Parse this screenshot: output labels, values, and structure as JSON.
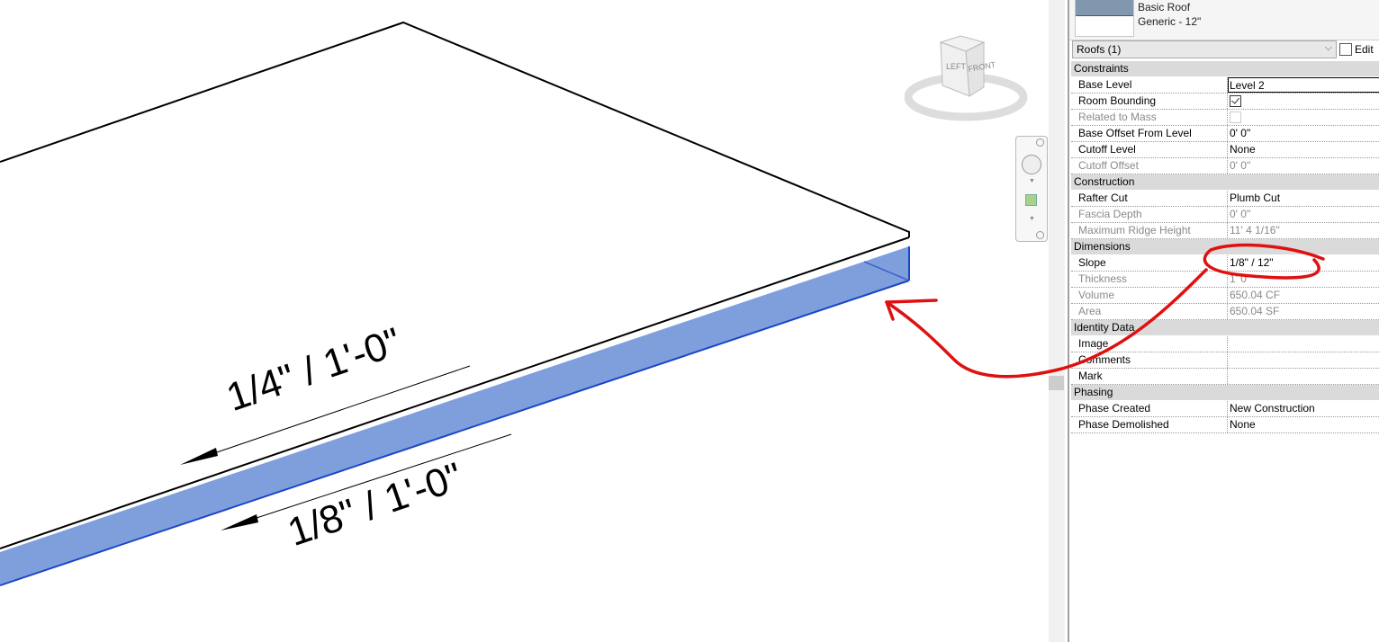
{
  "viewport": {
    "annotations": [
      "1/4\" / 1'-0\"",
      "1/8\" / 1'-0\""
    ],
    "viewcube": {
      "left_face": "LEFT",
      "front_face": "FRONT"
    },
    "colors": {
      "selection_face": "#7f9fdc",
      "selection_edge": "#1a45c8",
      "markup": "#e01010"
    }
  },
  "properties": {
    "type_family": "Basic Roof",
    "type_name": "Generic - 12\"",
    "filter": "Roofs (1)",
    "edit_type": "Edit",
    "groups": [
      {
        "name": "Constraints",
        "rows": [
          {
            "label": "Base Level",
            "value": "Level 2"
          },
          {
            "label": "Room Bounding",
            "value": "",
            "checkbox": true,
            "checked": true
          },
          {
            "label": "Related to Mass",
            "value": "",
            "checkbox": true,
            "checked": false,
            "disabled": true
          },
          {
            "label": "Base Offset From Level",
            "value": "0'  0\""
          },
          {
            "label": "Cutoff Level",
            "value": "None"
          },
          {
            "label": "Cutoff Offset",
            "value": "0'  0\"",
            "disabled": true
          }
        ]
      },
      {
        "name": "Construction",
        "rows": [
          {
            "label": "Rafter Cut",
            "value": "Plumb Cut"
          },
          {
            "label": "Fascia Depth",
            "value": "0'  0\"",
            "disabled": true
          },
          {
            "label": "Maximum Ridge Height",
            "value": "11'  4 1/16\"",
            "disabled": true
          }
        ]
      },
      {
        "name": "Dimensions",
        "rows": [
          {
            "label": "Slope",
            "value": "1/8\" / 12\""
          },
          {
            "label": "Thickness",
            "value": "1'  0\"",
            "disabled": true
          },
          {
            "label": "Volume",
            "value": "650.04 CF",
            "disabled": true
          },
          {
            "label": "Area",
            "value": "650.04 SF",
            "disabled": true
          }
        ]
      },
      {
        "name": "Identity Data",
        "rows": [
          {
            "label": "Image",
            "value": ""
          },
          {
            "label": "Comments",
            "value": ""
          },
          {
            "label": "Mark",
            "value": ""
          }
        ]
      },
      {
        "name": "Phasing",
        "rows": [
          {
            "label": "Phase Created",
            "value": "New Construction"
          },
          {
            "label": "Phase Demolished",
            "value": "None"
          }
        ]
      }
    ]
  }
}
